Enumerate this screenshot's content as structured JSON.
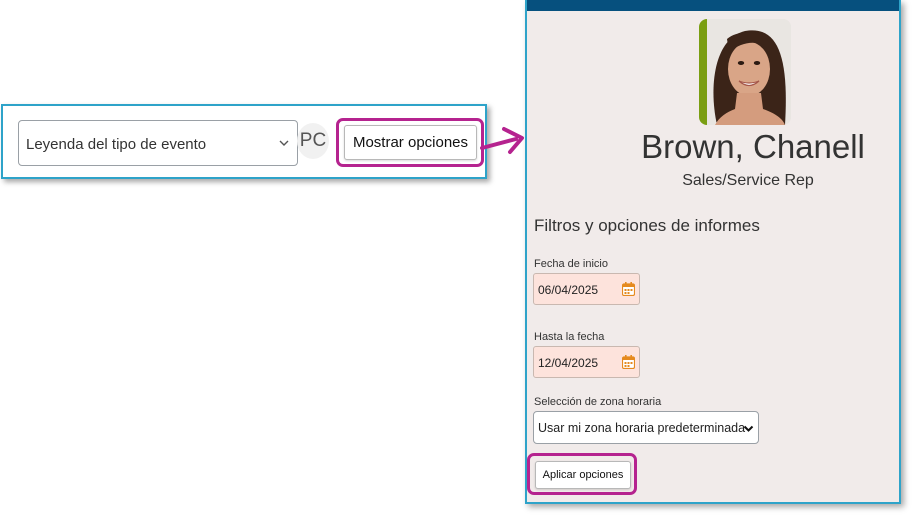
{
  "toolbar": {
    "event_type_select": "Leyenda del tipo de evento",
    "avatar_initials": "PC",
    "show_options_label": "Mostrar opciones"
  },
  "panel": {
    "employee_name": "Brown, Chanell",
    "employee_role": "Sales/Service Rep",
    "section_title": "Filtros y opciones de informes",
    "start_date": {
      "label": "Fecha de inicio",
      "value": "06/04/2025"
    },
    "end_date": {
      "label": "Hasta la fecha",
      "value": "12/04/2025"
    },
    "timezone": {
      "label": "Selección de zona horaria",
      "value": "Usar mi zona horaria predeterminada"
    },
    "apply_label": "Aplicar opciones"
  },
  "colors": {
    "highlight": "#b5238f",
    "frame": "#2ea3c9",
    "panel_bg": "#f1ebea",
    "top_bar": "#06507e",
    "date_bg": "#fde3dc",
    "photo_accent": "#7a9e12"
  },
  "icons": [
    "chevron-down-icon",
    "calendar-icon",
    "arrow-right-icon"
  ]
}
